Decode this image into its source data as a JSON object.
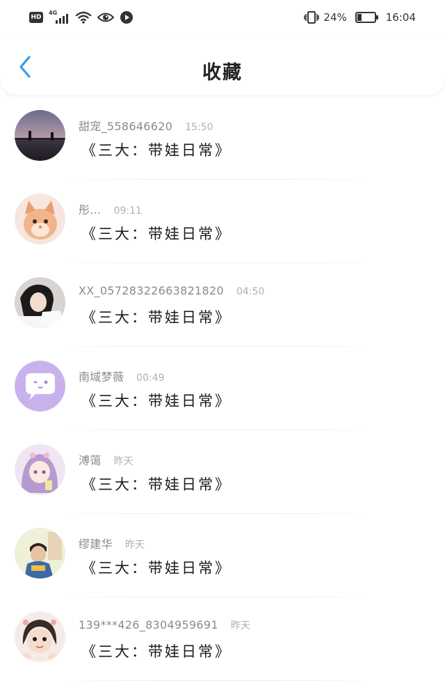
{
  "status_bar": {
    "network": "4G",
    "hd": "HD",
    "battery_percent": "24%",
    "battery_level": 0.24,
    "time": "16:04"
  },
  "header": {
    "title": "收藏",
    "back_icon": "chevron-left-icon"
  },
  "colors": {
    "accent": "#2f9df0",
    "name_text": "#8a8a8a",
    "time_text": "#b0b0b0",
    "title_text": "#1c1c1c"
  },
  "favorites": [
    {
      "user": "甜宠_558646620",
      "time": "15:50",
      "title": "《三大：带娃日常》",
      "avatar": "sunset-bridge-avatar"
    },
    {
      "user": "彤…",
      "time": "09:11",
      "title": "《三大：带娃日常》",
      "avatar": "kitten-avatar"
    },
    {
      "user": "XX_05728322663821820",
      "time": "04:50",
      "title": "《三大：带娃日常》",
      "avatar": "girl-photo-avatar"
    },
    {
      "user": "南域梦薇",
      "time": "00:49",
      "title": "《三大：带娃日常》",
      "avatar": "chat-bubble-avatar"
    },
    {
      "user": "溥蔼",
      "time": "昨天",
      "title": "《三大：带娃日常》",
      "avatar": "anime-girl-avatar"
    },
    {
      "user": "缪建华",
      "time": "昨天",
      "title": "《三大：带娃日常》",
      "avatar": "boy-photo-avatar"
    },
    {
      "user": "139***426_8304959691",
      "time": "昨天",
      "title": "《三大：带娃日常》",
      "avatar": "child-photo-avatar"
    }
  ]
}
